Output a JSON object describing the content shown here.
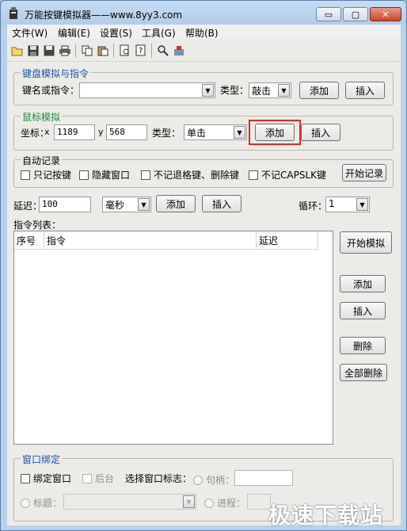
{
  "window": {
    "title": "万能按键模拟器——www.8yy3.com",
    "caption_buttons": {
      "minimize": "▭",
      "maximize": "▢",
      "close": "✕"
    }
  },
  "menu": [
    "文件(W)",
    "编辑(E)",
    "设置(S)",
    "工具(G)",
    "帮助(B)"
  ],
  "toolbar_icons": [
    "open-folder-icon",
    "save-icon",
    "save-as-icon",
    "print-icon",
    "copy-icon",
    "paste-icon",
    "print-preview-icon",
    "help-icon",
    "search-icon",
    "tools-icon"
  ],
  "keyboard": {
    "legend": "键盘模拟与指令",
    "key_label": "键名或指令：",
    "key_value": "",
    "type_label": "类型：",
    "type_value": "敲击",
    "add": "添加",
    "insert": "插入"
  },
  "mouse": {
    "legend": "鼠标模拟",
    "coord_label": "坐标：",
    "x_label": "x",
    "x_value": "1189",
    "y_label": "y",
    "y_value": "568",
    "type_label": "类型：",
    "type_value": "单击",
    "add": "添加",
    "insert": "插入"
  },
  "autorecord": {
    "legend": "自动记录",
    "options": [
      "只记按键",
      "隐藏窗口",
      "不记退格键、删除键",
      "不记CAPSLK键"
    ],
    "start": "开始记录"
  },
  "delay": {
    "label": "延迟：",
    "value": "100",
    "unit": "毫秒",
    "add": "添加",
    "insert": "插入",
    "loop_label": "循环：",
    "loop_value": "1"
  },
  "list": {
    "label": "指令列表：",
    "columns": [
      "序号",
      "指令",
      "延迟"
    ],
    "rows": []
  },
  "side_buttons": {
    "start_sim": "开始模拟",
    "add": "添加",
    "insert": "插入",
    "delete": "删除",
    "delete_all": "全部删除"
  },
  "bind": {
    "legend": "窗口绑定",
    "bind_window": "绑定窗口",
    "background": "后台",
    "select_flag": "选择窗口标志：",
    "handle": "句柄：",
    "handle_value": "",
    "title": "标题：",
    "process": "进程："
  },
  "watermark": "极速下载站"
}
